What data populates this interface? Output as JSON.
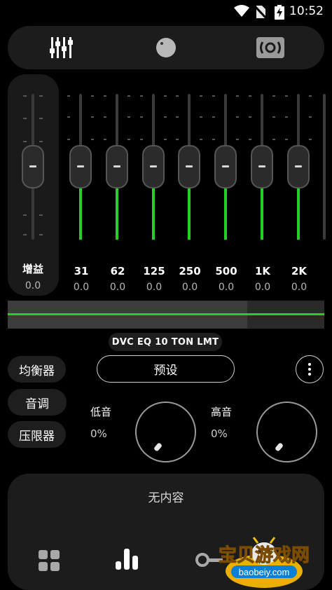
{
  "status_bar": {
    "time": "10:52",
    "icons": [
      "wifi-icon",
      "no-sim-icon",
      "battery-charging-icon"
    ]
  },
  "top_tabs": [
    {
      "name": "equalizer-sliders-icon",
      "active": true
    },
    {
      "name": "knob-icon",
      "active": false
    },
    {
      "name": "speaker-icon",
      "active": false
    }
  ],
  "gain": {
    "label": "增益",
    "value": "0.0",
    "level": 0.5
  },
  "bands": [
    {
      "label": "31",
      "value": "0.0",
      "level": 0.5
    },
    {
      "label": "62",
      "value": "0.0",
      "level": 0.5
    },
    {
      "label": "125",
      "value": "0.0",
      "level": 0.5
    },
    {
      "label": "250",
      "value": "0.0",
      "level": 0.5
    },
    {
      "label": "500",
      "value": "0.0",
      "level": 0.5
    },
    {
      "label": "1K",
      "value": "0.0",
      "level": 0.5
    },
    {
      "label": "2K",
      "value": "0.0",
      "level": 0.5
    }
  ],
  "preset_name": "DVC EQ 10 TON LMT",
  "side_buttons": [
    "均衡器",
    "音调",
    "压限器"
  ],
  "preset_button": "预设",
  "bass": {
    "label": "低音",
    "value": "0%"
  },
  "treble": {
    "label": "高音",
    "value": "0%"
  },
  "empty_message": "无内容",
  "bottom_nav": [
    "grid-icon",
    "bars-icon",
    "key-icon"
  ],
  "watermark": {
    "title": "宝贝游戏网",
    "url": "baobeiy.com"
  },
  "colors": {
    "accent": "#24d024",
    "background": "#000000",
    "panel": "#1c1c1c"
  }
}
